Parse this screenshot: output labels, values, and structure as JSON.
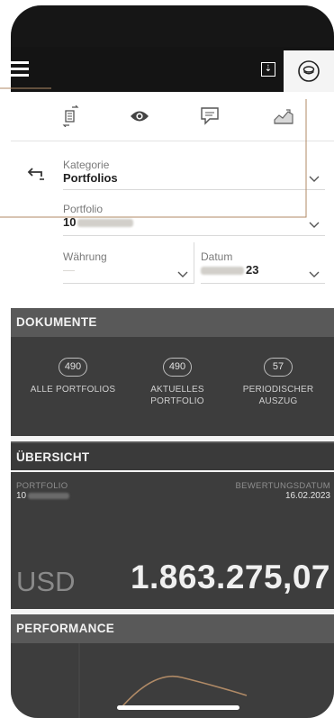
{
  "toolbar": {
    "menu_icon": "hamburger-menu-icon",
    "download_icon": "download-icon",
    "download_glyph": "⇣",
    "account_icon": "account-circle-icon"
  },
  "icon_tabs": [
    "transfer-icon",
    "eye-icon",
    "chat-icon",
    "chart-icon"
  ],
  "filters": {
    "kategorie": {
      "label": "Kategorie",
      "value": "Portfolios"
    },
    "portfolio": {
      "label": "Portfolio",
      "value_prefix": "10"
    },
    "waehrung": {
      "label": "Währung",
      "value": "—"
    },
    "datum": {
      "label": "Datum",
      "value_suffix": "23"
    }
  },
  "dokumente": {
    "title": "DOKUMENTE",
    "items": [
      {
        "count": "490",
        "label_line1": "ALLE PORTFOLIOS",
        "label_line2": ""
      },
      {
        "count": "490",
        "label_line1": "AKTUELLES",
        "label_line2": "PORTFOLIO"
      },
      {
        "count": "57",
        "label_line1": "PERIODISCHER",
        "label_line2": "AUSZUG"
      }
    ]
  },
  "uebersicht": {
    "title": "ÜBERSICHT",
    "portfolio_label": "PORTFOLIO",
    "portfolio_prefix": "10",
    "bewertung_label": "BEWERTUNGSDATUM",
    "bewertung_date": "16.02.2023",
    "currency": "USD",
    "amount": "1.863.275,07"
  },
  "performance": {
    "title": "PERFORMANCE"
  },
  "colors": {
    "accent": "#b08a66",
    "dark_bg": "#3d3d3d",
    "section_bg": "#595959",
    "appbar_bg": "#141414"
  }
}
